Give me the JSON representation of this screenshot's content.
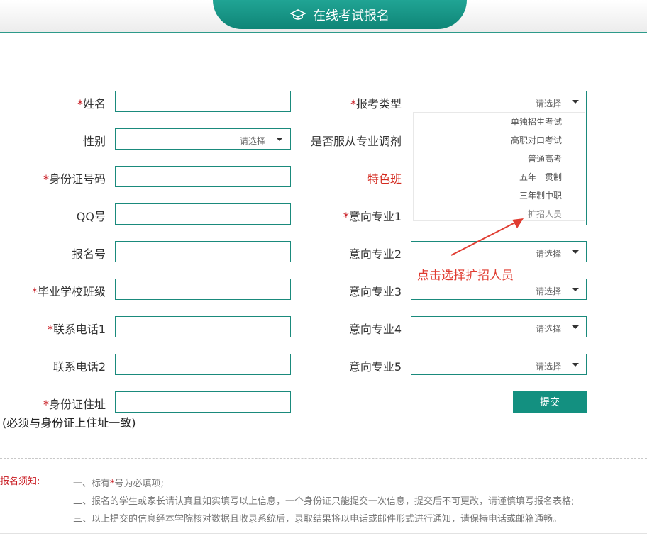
{
  "header": {
    "title": "在线考试报名",
    "icon": "graduation-cap-icon"
  },
  "colors": {
    "accent": "#139080",
    "required": "#c7161d",
    "annotation": "#e03c31"
  },
  "required_mark": "*",
  "left_fields": [
    {
      "label": "姓名",
      "required": true,
      "type": "text",
      "value": ""
    },
    {
      "label": "性别",
      "required": false,
      "type": "select",
      "value": "请选择"
    },
    {
      "label": "身份证号码",
      "required": true,
      "type": "text",
      "value": ""
    },
    {
      "label": "QQ号",
      "required": false,
      "type": "text",
      "value": ""
    },
    {
      "label": "报名号",
      "required": false,
      "type": "text",
      "value": ""
    },
    {
      "label": "毕业学校班级",
      "required": true,
      "type": "text",
      "value": ""
    },
    {
      "label": "联系电话1",
      "required": true,
      "type": "text",
      "value": ""
    },
    {
      "label": "联系电话2",
      "required": false,
      "type": "text",
      "value": ""
    },
    {
      "label": "身份证住址",
      "required": true,
      "type": "text",
      "value": ""
    }
  ],
  "address_note": "(必须与身份证上住址一致)",
  "right_fields": {
    "exam_type": {
      "label": "报考类型",
      "required": true,
      "placeholder": "请选择",
      "options": [
        "单独招生考试",
        "高职对口考试",
        "普通高考",
        "五年一贯制",
        "三年制中职",
        "扩招人员"
      ]
    },
    "obey_adjust": {
      "label": "是否服从专业调剂"
    },
    "special_class": {
      "label": "特色班"
    },
    "major1": {
      "label": "意向专业1",
      "required": true
    },
    "major2": {
      "label": "意向专业2",
      "placeholder": "请选择"
    },
    "major3": {
      "label": "意向专业3",
      "placeholder": "请选择"
    },
    "major4": {
      "label": "意向专业4",
      "placeholder": "请选择"
    },
    "major5": {
      "label": "意向专业5",
      "placeholder": "请选择"
    }
  },
  "submit_label": "提交",
  "annotation": "点击选择扩招人员",
  "notice": {
    "title": "报名须知:",
    "item1_before": "一、标有",
    "item1_after": "号为必填项;",
    "item2": "二、报名的学生或家长请认真且如实填写以上信息，一个身份证只能提交一次信息，提交后不可更改，请谨慎填写报名表格;",
    "item3": "三、以上提交的信息经本学院核对数据且收录系统后，录取结果将以电话或邮件形式进行通知，请保持电话或邮箱通畅。"
  }
}
